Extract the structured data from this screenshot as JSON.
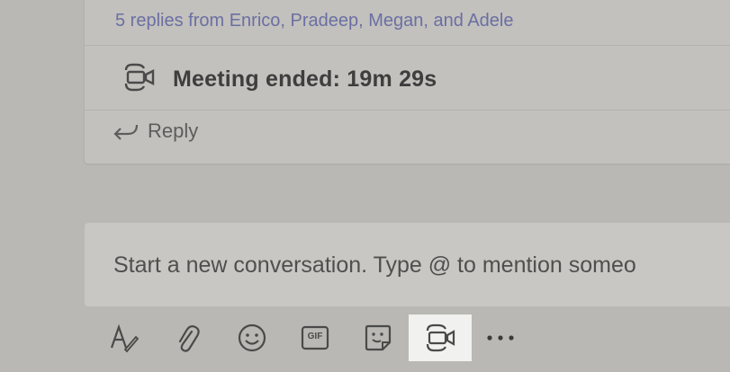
{
  "thread": {
    "replies_summary": "5 replies from Enrico, Pradeep, Megan, and Adele",
    "meeting_status": "Meeting ended: 19m 29s",
    "reply_label": "Reply"
  },
  "compose": {
    "placeholder": "Start a new conversation. Type @ to mention someo"
  },
  "toolbar": {
    "gif_label": "GIF",
    "icons": [
      "format-icon",
      "attach-icon",
      "emoji-icon",
      "gif-icon",
      "sticker-icon",
      "meet-now-icon",
      "more-options-icon"
    ]
  },
  "colors": {
    "accent_link": "#6b6fa3",
    "background": "#b9b8b4"
  }
}
